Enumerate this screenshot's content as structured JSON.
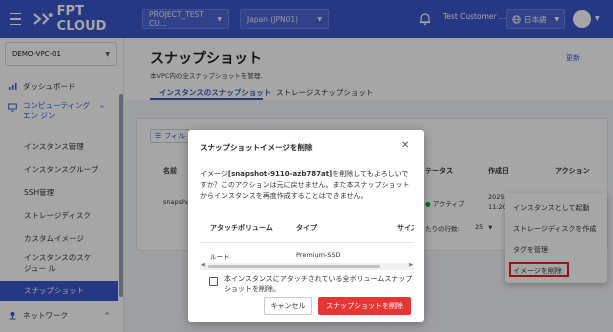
{
  "topbar": {
    "logo_text": "FPT CLOUD",
    "project_select": "PROJECT_TEST CU...",
    "region_select": "Japan (JPN01)",
    "user_name": "Test Customer ...",
    "language": "日本語"
  },
  "sidebar": {
    "vpc_select": "DEMO-VPC-01",
    "dashboard": "ダッシュボード",
    "computing_engine": "コンピューティング エン ジン",
    "subitems": [
      "インスタンス管理",
      "インスタンスグループ",
      "SSH管理",
      "ストレージディスク",
      "カスタムイメージ",
      "インスタンスのスケジュー ル",
      "スナップショット"
    ],
    "network": "ネットワーク"
  },
  "page": {
    "title": "スナップショット",
    "subtitle": "本VPC内の全スナップショットを管理.",
    "refresh": "更新",
    "tabs": [
      "インスタンスのスナップショット",
      "ストレージスナップショット"
    ],
    "filter_label": "フィル",
    "columns": {
      "name": "名前",
      "status": "テータス",
      "created": "作成日",
      "action": "アクション"
    },
    "row": {
      "name": "snapshot",
      "status": "アクティブ",
      "date": "2025-",
      "time": "11:20"
    },
    "pager": {
      "rows_label": "たりの行数:",
      "rows_value": "25"
    }
  },
  "context_menu": {
    "items": [
      "インスタンスとして起動",
      "ストレージディスクを作成",
      "タグを管理",
      "イメージを削除"
    ]
  },
  "modal": {
    "title": "スナップショットイメージを削除",
    "body_prefix": "イメージ",
    "body_snapshot": "[snapshot-9110-azb787at]",
    "body_rest": "を削除してもよろしいですか？このアクションは元に戻せません。また本スナップショットからインスタンスを再度作成することはできません。",
    "columns": [
      "アタッチボリューム",
      "タイプ",
      "サイズ"
    ],
    "row": {
      "volume": "ルート",
      "type": "Premium-SSD"
    },
    "checkbox_label": "本インスタンスにアタッチされている全ボリュームスナップショットを削除。",
    "cancel": "キャンセル",
    "confirm": "スナップショットを削除"
  },
  "colors": {
    "primary": "#3b55c9",
    "danger": "#e53535"
  }
}
